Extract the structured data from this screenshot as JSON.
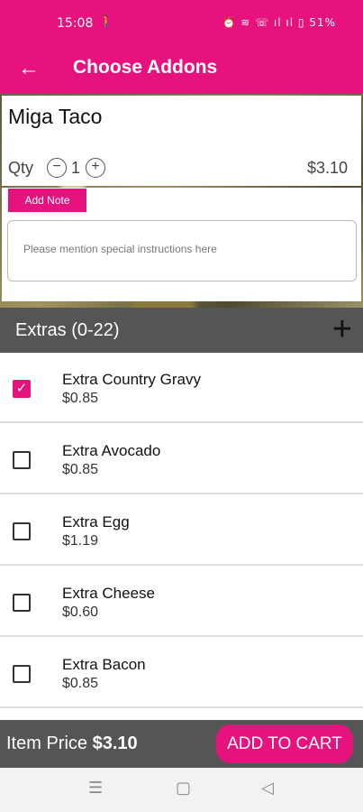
{
  "status": {
    "time": "15:08",
    "runner_icon": "person-walk",
    "battery": "51%",
    "icons_text": "⏰ ≋ ☏ ıl ıl ▯"
  },
  "appbar": {
    "back_icon": "arrow-left-icon",
    "title": "Choose Addons"
  },
  "item": {
    "name": "Miga Taco",
    "qty_label": "Qty",
    "qty": "1",
    "price": "$3.10"
  },
  "note": {
    "button_label": "Add Note",
    "placeholder": "Please mention special instructions here"
  },
  "extras": {
    "header": "Extras (0-22)",
    "items": [
      {
        "name": "Extra Country Gravy",
        "price": "$0.85",
        "checked": true
      },
      {
        "name": "Extra Avocado",
        "price": "$0.85",
        "checked": false
      },
      {
        "name": "Extra Egg",
        "price": "$1.19",
        "checked": false
      },
      {
        "name": "Extra Cheese",
        "price": "$0.60",
        "checked": false
      },
      {
        "name": "Extra Bacon",
        "price": "$0.85",
        "checked": false
      }
    ]
  },
  "footer": {
    "item_price_label": "Item Price",
    "item_price_value": "$3.10",
    "cart_button": "ADD TO CART"
  },
  "colors": {
    "accent": "#e6137e",
    "header_bg": "#555555"
  }
}
